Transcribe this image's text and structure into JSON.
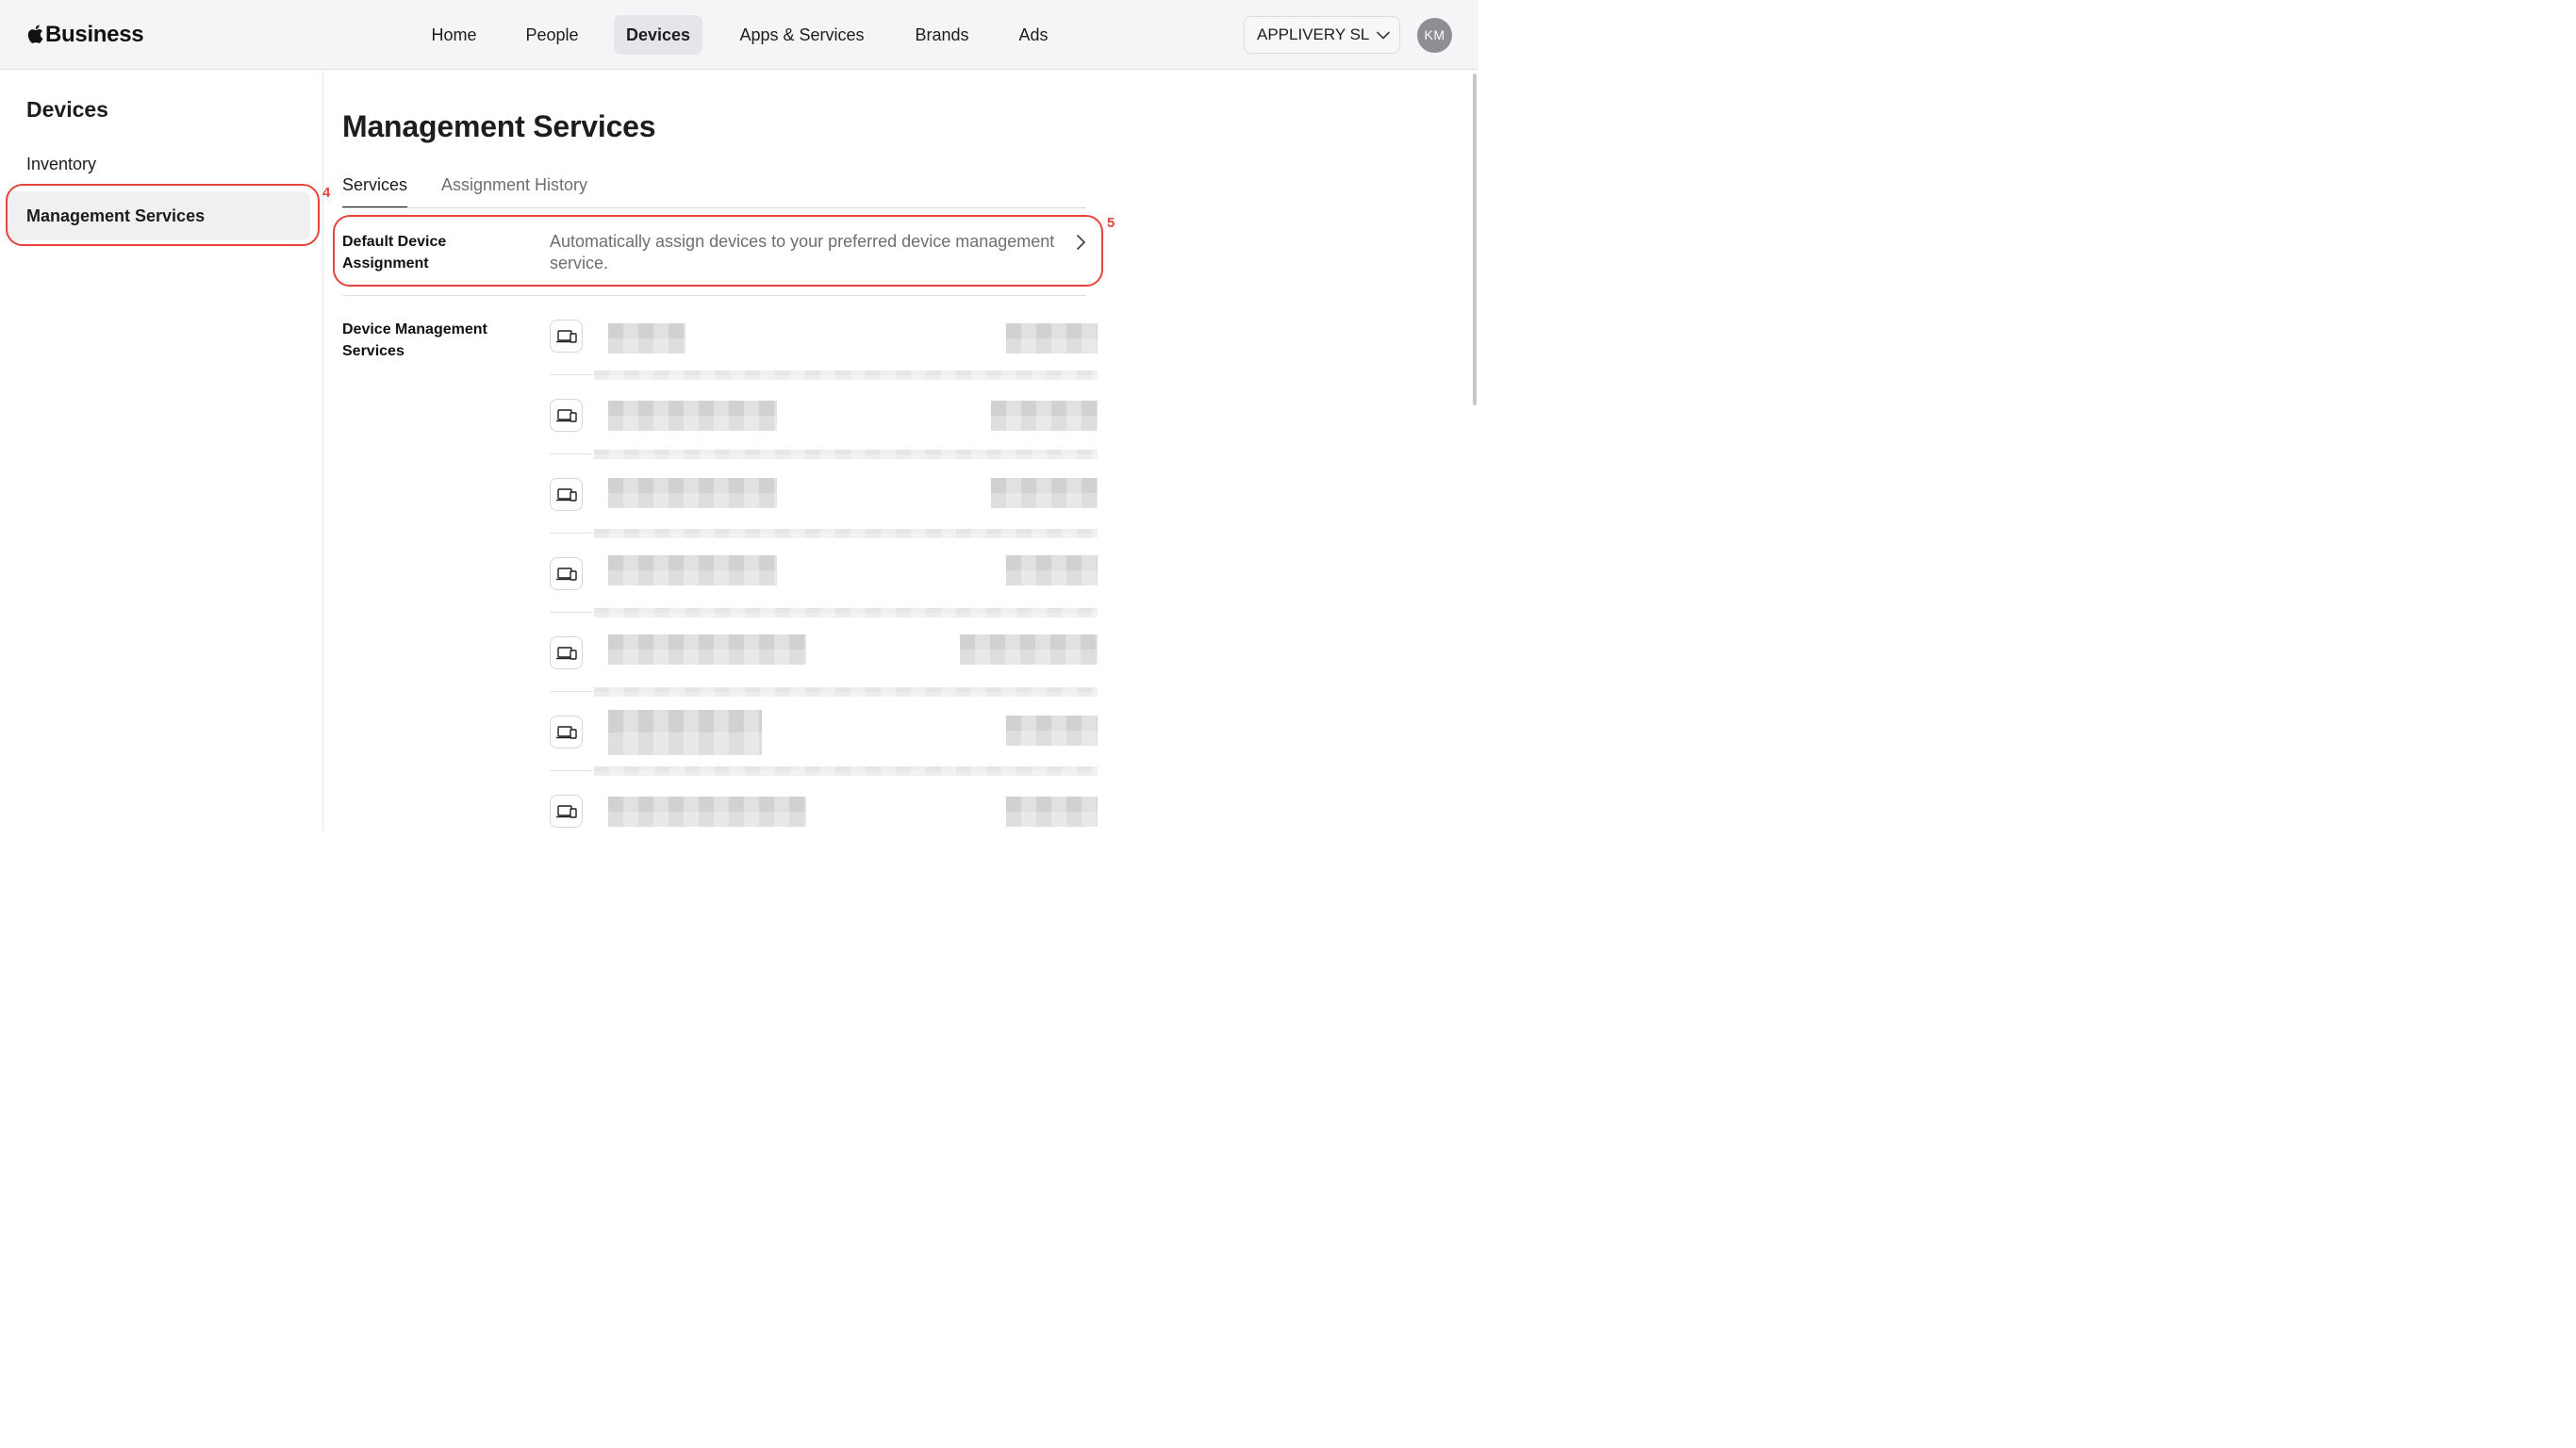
{
  "header": {
    "brand_label": "Business",
    "nav": [
      {
        "label": "Home"
      },
      {
        "label": "People"
      },
      {
        "label": "Devices",
        "active": true
      },
      {
        "label": "Apps & Services"
      },
      {
        "label": "Brands"
      },
      {
        "label": "Ads"
      }
    ],
    "organization": "APPLIVERY SL",
    "avatar_initials": "KM"
  },
  "sidebar": {
    "title": "Devices",
    "items": [
      {
        "label": "Inventory"
      },
      {
        "label": "Management Services",
        "selected": true
      }
    ]
  },
  "main": {
    "title": "Management Services",
    "tabs": [
      {
        "label": "Services",
        "active": true
      },
      {
        "label": "Assignment History"
      }
    ],
    "default_assignment": {
      "label": "Default Device Assignment",
      "description": "Automatically assign devices to your preferred device management service."
    },
    "services_section": {
      "label": "Device Management Services",
      "items_count_visible": 7
    }
  },
  "annotations": [
    {
      "number": "4",
      "target": "Management Services"
    },
    {
      "number": "5",
      "target": "Default Device Assignment"
    }
  ],
  "colors": {
    "accent_annotation": "#e5453a",
    "topbar_bg": "#f5f5f7",
    "active_nav_bg": "#e6e6ea"
  }
}
